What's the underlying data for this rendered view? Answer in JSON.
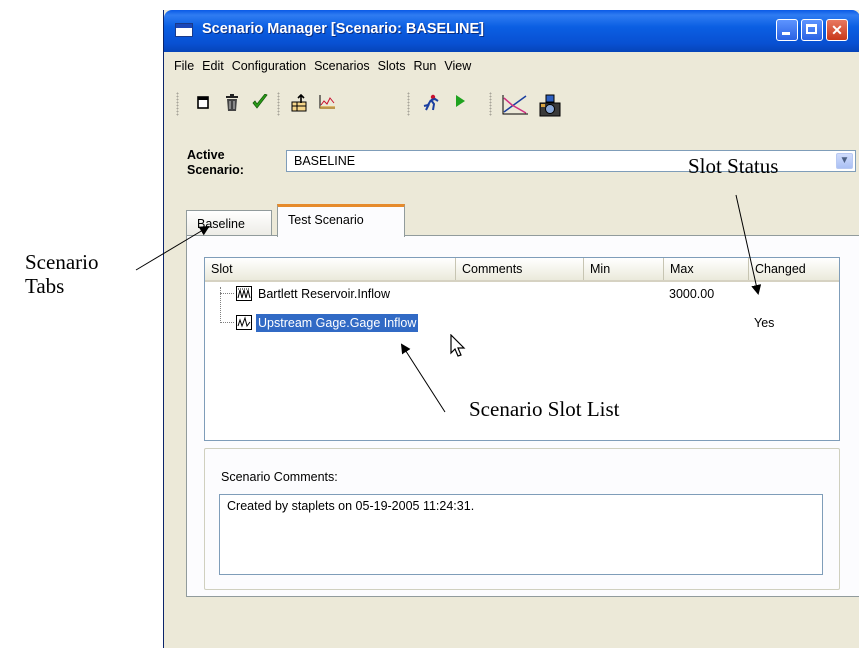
{
  "window": {
    "title": "Scenario Manager [Scenario: BASELINE]",
    "controls": [
      "minimize",
      "maximize",
      "close"
    ]
  },
  "menu": [
    "File",
    "Edit",
    "Configuration",
    "Scenarios",
    "Slots",
    "Run",
    "View"
  ],
  "toolbar": {
    "icons": [
      "new-icon",
      "delete-icon",
      "checkmark-icon",
      "export-icon",
      "chart-icon",
      "run-figure-icon",
      "play-icon",
      "plot-icon",
      "snapshot-icon"
    ]
  },
  "active_scenario": {
    "label": "Active Scenario:",
    "value": "BASELINE"
  },
  "tabs": [
    {
      "label": "Baseline",
      "selected": false
    },
    {
      "label": "Test Scenario",
      "selected": true
    }
  ],
  "slot_list": {
    "columns": [
      "Slot",
      "Comments",
      "Min",
      "Max",
      "Changed"
    ],
    "rows": [
      {
        "slot": "Bartlett Reservoir.Inflow",
        "comments": "",
        "min": "",
        "max": "3000.00",
        "changed": "",
        "selected": false
      },
      {
        "slot": "Upstream Gage.Gage Inflow",
        "comments": "",
        "min": "",
        "max": "",
        "changed": "Yes",
        "selected": true
      }
    ]
  },
  "comments": {
    "label": "Scenario Comments:",
    "text": "Created by staplets on 05-19-2005 11:24:31."
  },
  "annotations": {
    "slot_status": "Slot Status",
    "scenario_tabs_line1": "Scenario",
    "scenario_tabs_line2": "Tabs",
    "scenario_slot_list": "Scenario Slot List"
  },
  "colors": {
    "title_bar": "#0a5ae6",
    "selection": "#316ac5",
    "active_tab_accent": "#e68b2c",
    "window_bg": "#ece9d8"
  }
}
